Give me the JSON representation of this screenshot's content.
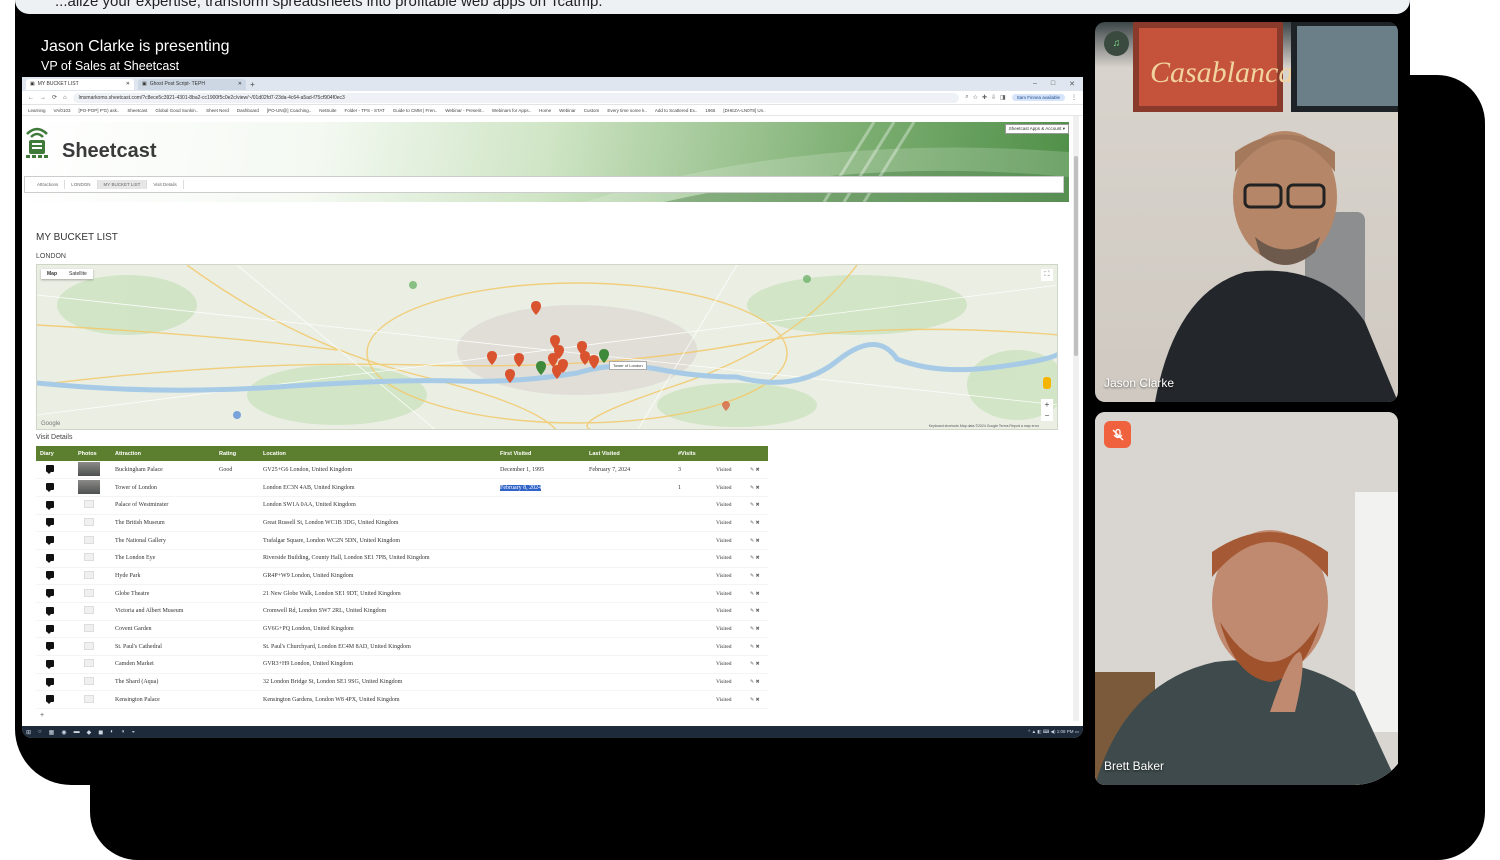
{
  "banner_text": "...alize your expertise, transform spreadsheets into profitable web apps on Tcatmp.",
  "presenter": {
    "line1": "Jason Clarke is presenting",
    "line2": "VP of Sales at Sheetcast"
  },
  "browser": {
    "tabs": [
      {
        "label": "MY BUCKET LIST",
        "active": true
      },
      {
        "label": "Ghost Post Script- TEPH",
        "active": false
      }
    ],
    "new_tab": "+",
    "window_controls": [
      "–",
      "□",
      "✕"
    ],
    "nav": {
      "back": "←",
      "forward": "→",
      "reload": "⟳",
      "home": "⌂"
    },
    "url": "lmsmarkomo.sheetcast.com/?c8ece5c3921-4301-8ba2-cc1900f5c0e2c/view/~/01d02fd7-23da-4c64-a5ad-f75cf904f0ec3",
    "profile_button": "Sam Finnea available",
    "bookmarks": [
      "Learning",
      "VA/0103",
      "[PO-POP] P'G) ask..",
      "Sheetcast",
      "Global Good Sunkin..",
      "Sheet Nerd",
      "Dashboard",
      "[PO-UN@] Coaching..",
      "NetSuite",
      "Folder - TPS - STAT",
      "Guide to CMM | Fren..",
      "Webinar - Preserit..",
      "Webinars for Apps..",
      "Home",
      "Webinar",
      "Custom",
      "Every time some k..",
      "Add to Scattered Ex..",
      "1965",
      "[DHEZA-LN0T8] Un.."
    ]
  },
  "app": {
    "logo": "Sheetcast",
    "apps_button": "Sheetcast Apps & Account ▾",
    "nav_items": [
      {
        "label": "Attractions",
        "active": false
      },
      {
        "label": "LONDON",
        "active": false
      },
      {
        "label": "MY BUCKET LIST",
        "active": true
      },
      {
        "label": "Visit Details",
        "active": false
      }
    ],
    "title": "MY BUCKET LIST",
    "subtitle": "LONDON",
    "map": {
      "map_type": [
        "Map",
        "Satellite"
      ],
      "tooltip": "Tower of London",
      "google": "Google",
      "footer": "Keyboard shortcuts   Map data ©2024 Google   Terms   Report a map error",
      "zoom_in": "+",
      "zoom_out": "−",
      "fullscreen": "⛶"
    },
    "visit_label": "Visit Details",
    "columns": [
      "Diary",
      "Photos",
      "Attraction",
      "Rating",
      "Location",
      "First Visited",
      "Last Visited",
      "#Visits",
      "",
      ""
    ],
    "rows": [
      {
        "attraction": "Buckingham Palace",
        "rating": "Good",
        "location": "GV25+G6 London, United Kingdom",
        "first": "December 1, 1995",
        "last": "February 7, 2024",
        "visits": "3",
        "status": "Visited",
        "photo": true,
        "hl": false
      },
      {
        "attraction": "Tower of London",
        "rating": "",
        "location": "London EC3N 4AB, United Kingdom",
        "first": "February 8, 2024",
        "last": "",
        "visits": "1",
        "status": "Visited",
        "photo": true,
        "hl": true
      },
      {
        "attraction": "Palace of Westminster",
        "rating": "",
        "location": "London SW1A 0AA, United Kingdom",
        "first": "",
        "last": "",
        "visits": "",
        "status": "Visited",
        "photo": false,
        "hl": false
      },
      {
        "attraction": "The British Museum",
        "rating": "",
        "location": "Great Russell St, London WC1B 3DG, United Kingdom",
        "first": "",
        "last": "",
        "visits": "",
        "status": "Visited",
        "photo": false,
        "hl": false
      },
      {
        "attraction": "The National Gallery",
        "rating": "",
        "location": "Trafalgar Square, London WC2N 5DN, United Kingdom",
        "first": "",
        "last": "",
        "visits": "",
        "status": "Visited",
        "photo": false,
        "hl": false
      },
      {
        "attraction": "The London Eye",
        "rating": "",
        "location": "Riverside Building, County Hall, London SE1 7PB, United Kingdom",
        "first": "",
        "last": "",
        "visits": "",
        "status": "Visited",
        "photo": false,
        "hl": false
      },
      {
        "attraction": "Hyde Park",
        "rating": "",
        "location": "GR4P+W9 London, United Kingdom",
        "first": "",
        "last": "",
        "visits": "",
        "status": "Visited",
        "photo": false,
        "hl": false
      },
      {
        "attraction": "Globe Theatre",
        "rating": "",
        "location": "21 New Globe Walk, London SE1 9DT, United Kingdom",
        "first": "",
        "last": "",
        "visits": "",
        "status": "Visited",
        "photo": false,
        "hl": false
      },
      {
        "attraction": "Victoria and Albert Museum",
        "rating": "",
        "location": "Cromwell Rd, London SW7 2RL, United Kingdom",
        "first": "",
        "last": "",
        "visits": "",
        "status": "Visited",
        "photo": false,
        "hl": false
      },
      {
        "attraction": "Covent Garden",
        "rating": "",
        "location": "GV6G+PQ London, United Kingdom",
        "first": "",
        "last": "",
        "visits": "",
        "status": "Visited",
        "photo": false,
        "hl": false
      },
      {
        "attraction": "St. Paul's Cathedral",
        "rating": "",
        "location": "St. Paul's Churchyard, London EC4M 8AD, United Kingdom",
        "first": "",
        "last": "",
        "visits": "",
        "status": "Visited",
        "photo": false,
        "hl": false
      },
      {
        "attraction": "Camden Market",
        "rating": "",
        "location": "GVR3+H9 London, United Kingdom",
        "first": "",
        "last": "",
        "visits": "",
        "status": "Visited",
        "photo": false,
        "hl": false
      },
      {
        "attraction": "The Shard (Aqua)",
        "rating": "",
        "location": "32 London Bridge St, London SE1 9SG, United Kingdom",
        "first": "",
        "last": "",
        "visits": "",
        "status": "Visited",
        "photo": false,
        "hl": false
      },
      {
        "attraction": "Kensington Palace",
        "rating": "",
        "location": "Kensington Gardens, London W8 4PX, United Kingdom",
        "first": "",
        "last": "",
        "visits": "",
        "status": "Visited",
        "photo": false,
        "hl": false
      }
    ],
    "row_controls": "✎ ✖",
    "add_row": "+"
  },
  "taskbar": {
    "items": [
      "⊞",
      "○",
      "▦",
      "◉",
      "▬",
      "◆",
      "◼",
      "◐",
      "◑",
      "◒"
    ],
    "tray": "^  ▲  ◧  ⌨  ◀)  1:08 PM  ▭"
  },
  "participants": [
    {
      "name": "Jason Clarke",
      "status": "speaking"
    },
    {
      "name": "Brett Baker",
      "status": "muted"
    }
  ],
  "colors": {
    "header_green": "#5b7f2e",
    "mute_red": "#f0623e",
    "highlight_blue": "#2f63c8"
  }
}
